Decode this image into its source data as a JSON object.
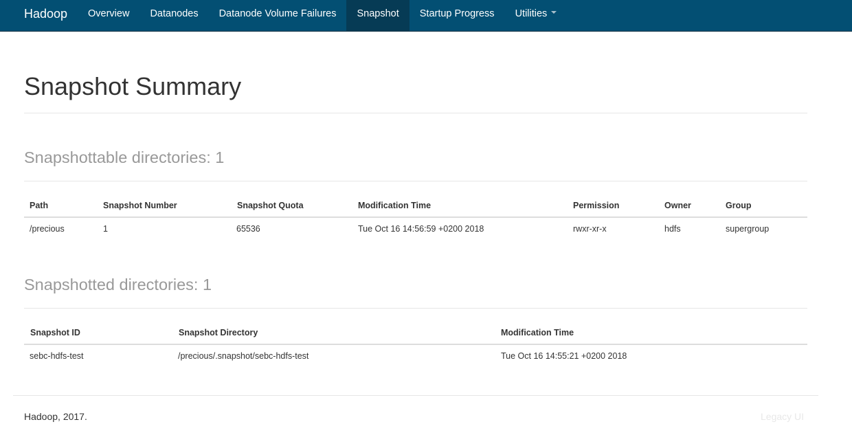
{
  "navbar": {
    "brand": "Hadoop",
    "items": [
      {
        "label": "Overview"
      },
      {
        "label": "Datanodes"
      },
      {
        "label": "Datanode Volume Failures"
      },
      {
        "label": "Snapshot"
      },
      {
        "label": "Startup Progress"
      },
      {
        "label": "Utilities"
      }
    ]
  },
  "page": {
    "title": "Snapshot Summary"
  },
  "snapshottable": {
    "title": "Snapshottable directories: 1",
    "headers": {
      "path": "Path",
      "snapshot_number": "Snapshot Number",
      "snapshot_quota": "Snapshot Quota",
      "modification_time": "Modification Time",
      "permission": "Permission",
      "owner": "Owner",
      "group": "Group"
    },
    "rows": [
      {
        "path": "/precious",
        "snapshot_number": "1",
        "snapshot_quota": "65536",
        "modification_time": "Tue Oct 16 14:56:59 +0200 2018",
        "permission": "rwxr-xr-x",
        "owner": "hdfs",
        "group": "supergroup"
      }
    ]
  },
  "snapshotted": {
    "title": "Snapshotted directories: 1",
    "headers": {
      "snapshot_id": "Snapshot ID",
      "snapshot_directory": "Snapshot Directory",
      "modification_time": "Modification Time"
    },
    "rows": [
      {
        "snapshot_id": "sebc-hdfs-test",
        "snapshot_directory": "/precious/.snapshot/sebc-hdfs-test",
        "modification_time": "Tue Oct 16 14:55:21 +0200 2018"
      }
    ]
  },
  "footer": {
    "copyright": "Hadoop, 2017.",
    "legacy_link": "Legacy UI"
  }
}
